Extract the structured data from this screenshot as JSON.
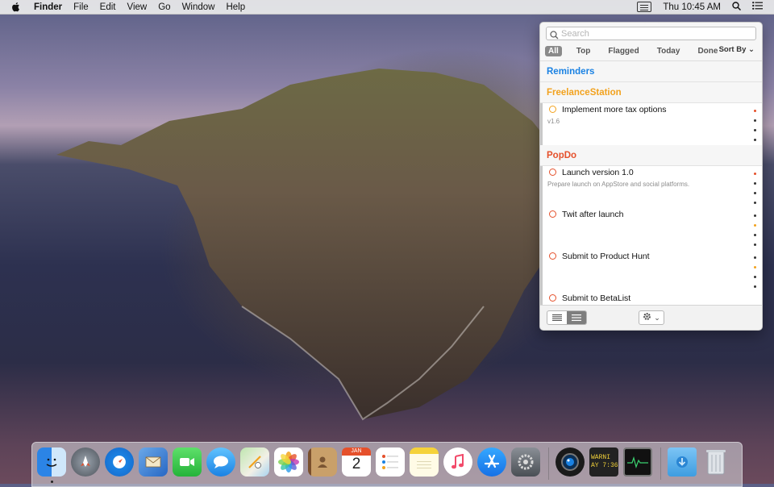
{
  "menubar": {
    "app_name": "Finder",
    "items": [
      "File",
      "Edit",
      "View",
      "Go",
      "Window",
      "Help"
    ],
    "clock": "Thu 10:45 AM"
  },
  "popover": {
    "search": {
      "placeholder": "Search",
      "value": ""
    },
    "filters": [
      "All",
      "Top",
      "Flagged",
      "Today",
      "Done"
    ],
    "active_filter": "All",
    "sort_label": "Sort By",
    "sections": [
      {
        "name": "Reminders",
        "color": "#1a82e3",
        "items": []
      },
      {
        "name": "FreelanceStation",
        "color": "#f2a21e",
        "items": [
          {
            "title": "Implement more tax options",
            "note": "v1.6",
            "circle_color": "#f2a21e"
          }
        ]
      },
      {
        "name": "PopDo",
        "color": "#e5502b",
        "items": [
          {
            "title": "Launch version 1.0",
            "note": "Prepare launch on AppStore and social platforms.",
            "circle_color": "#e5502b"
          },
          {
            "title": "Twit after launch",
            "note": "",
            "circle_color": "#e5502b"
          },
          {
            "title": "Submit to Product Hunt",
            "note": "",
            "circle_color": "#e5502b"
          },
          {
            "title": "Submit to BetaList",
            "note": "",
            "circle_color": "#e5502b"
          }
        ]
      }
    ]
  },
  "dock": {
    "apps": [
      "finder",
      "launchpad",
      "safari",
      "mail",
      "facetime",
      "messages",
      "maps",
      "photos",
      "contacts",
      "calendar",
      "reminders",
      "notes",
      "music",
      "app-store",
      "system-preferences",
      "camera",
      "console",
      "activity-monitor",
      "downloads",
      "trash"
    ],
    "calendar_month": "JAN",
    "calendar_day": "2",
    "console_text_1": "WARNI",
    "console_text_2": "AY 7:36"
  }
}
